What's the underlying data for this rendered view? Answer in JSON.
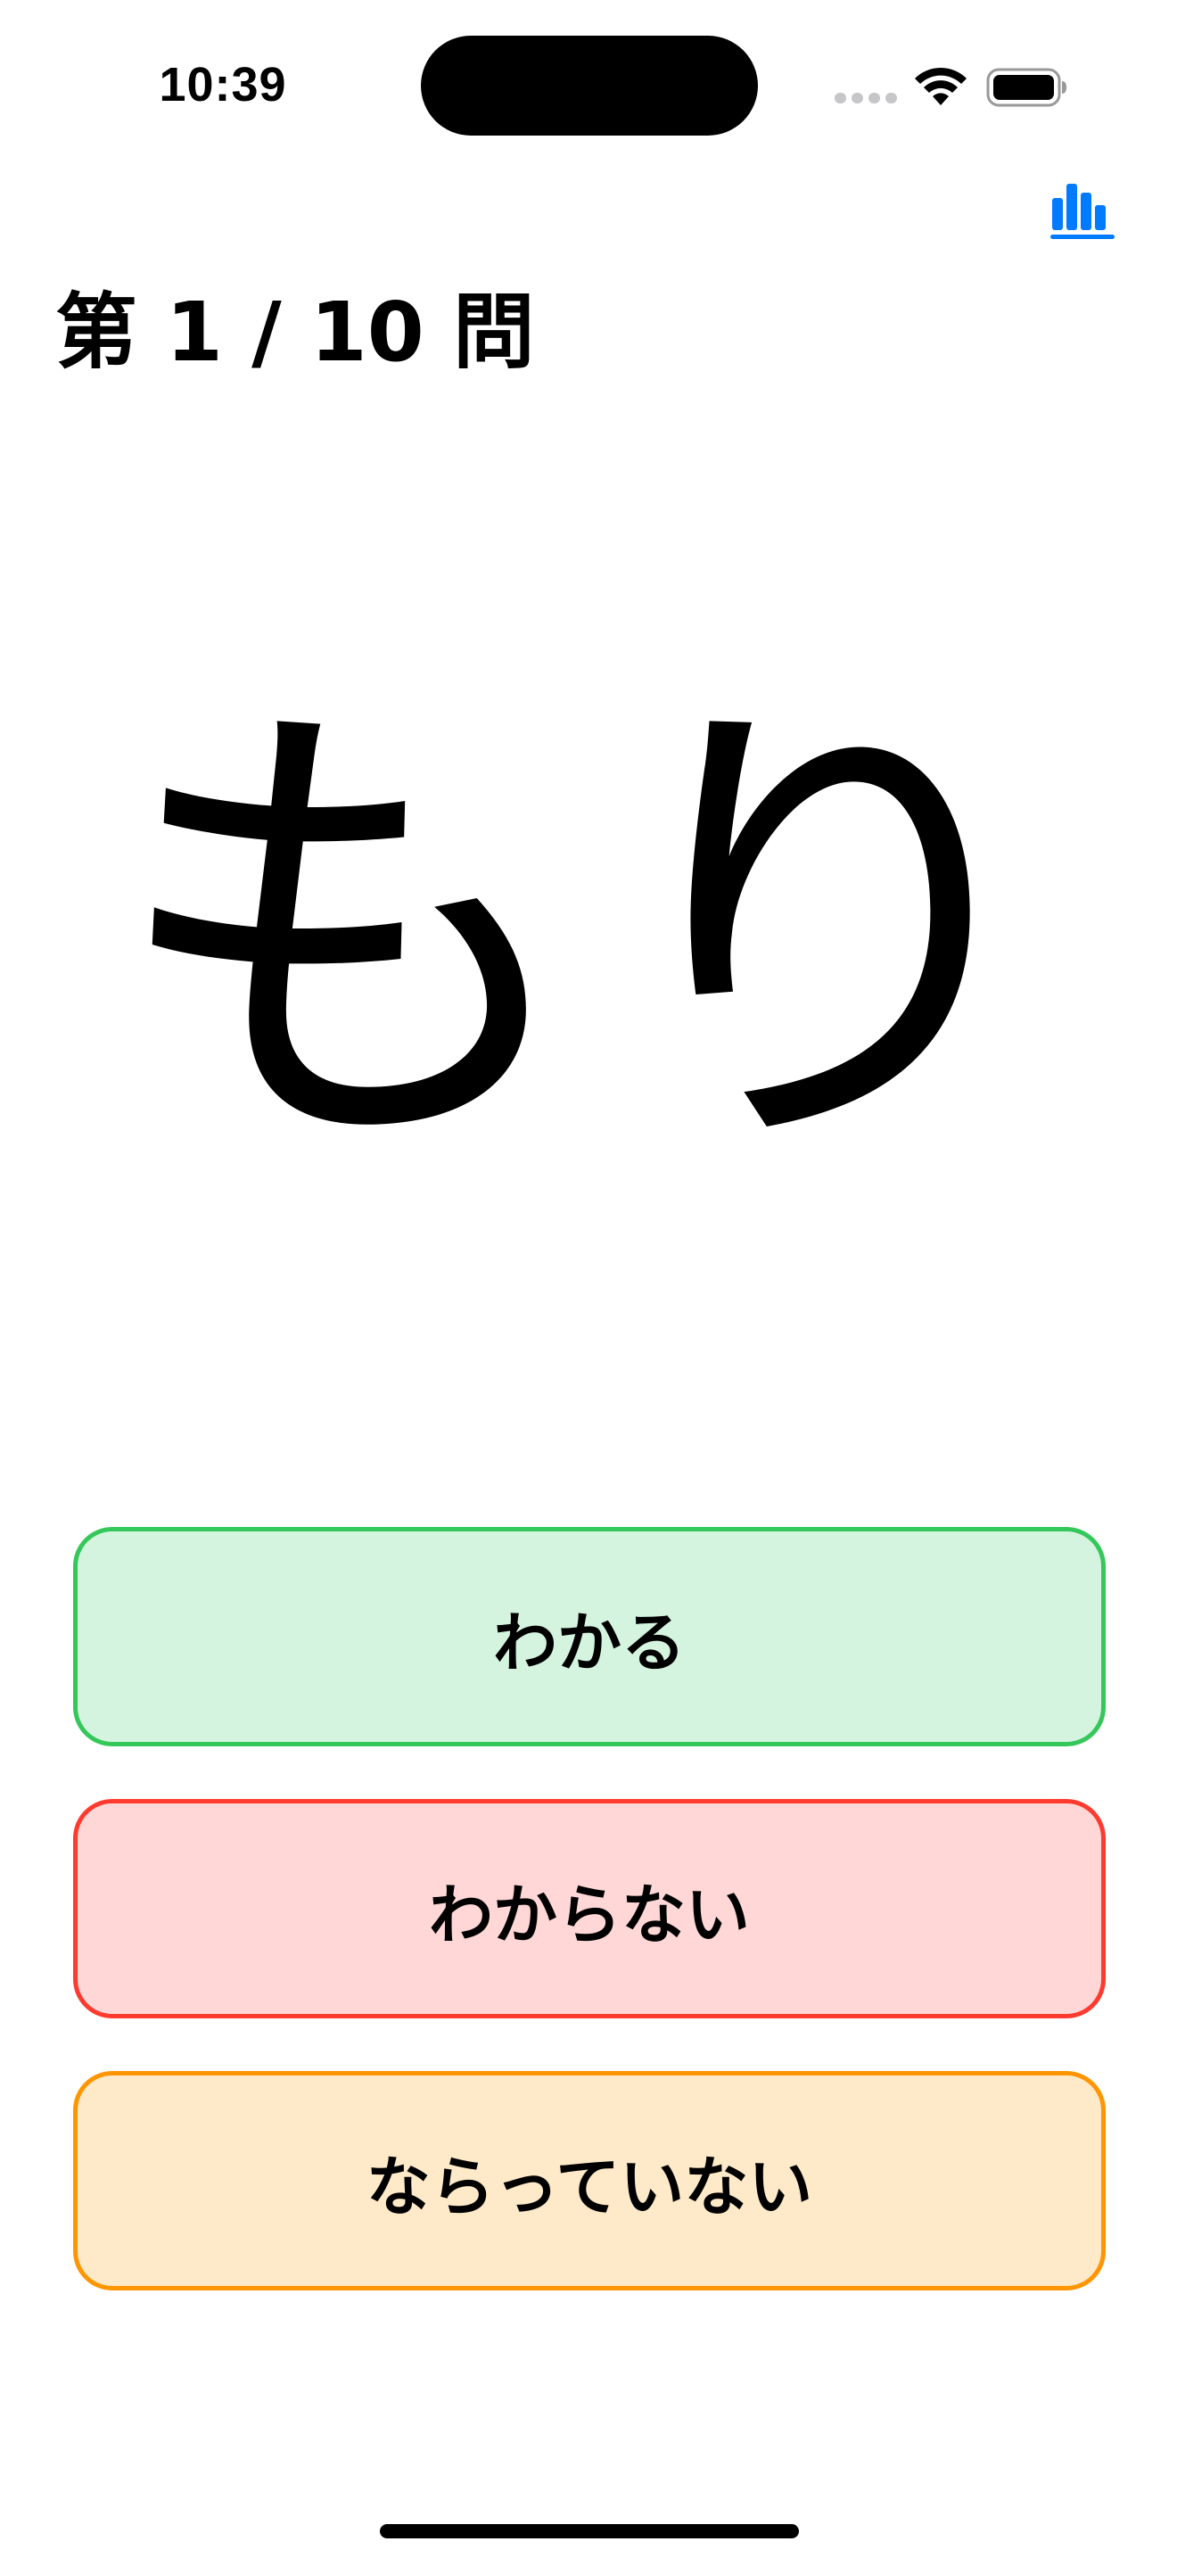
{
  "status_bar": {
    "time": "10:39"
  },
  "header": {
    "stats_icon": "bar-chart-icon",
    "question_counter": "第 1 / 10 問"
  },
  "question": {
    "word": "もり"
  },
  "answers": {
    "know_label": "わかる",
    "dont_know_label": "わからない",
    "not_learned_label": "ならっていない"
  },
  "colors": {
    "accent_blue": "#007aff",
    "know_border": "#34c759",
    "know_fill": "#d5f4df",
    "dont_know_border": "#ff3b30",
    "dont_know_fill": "#ffd7d6",
    "not_learned_border": "#ff9500",
    "not_learned_fill": "#fee9c9"
  }
}
